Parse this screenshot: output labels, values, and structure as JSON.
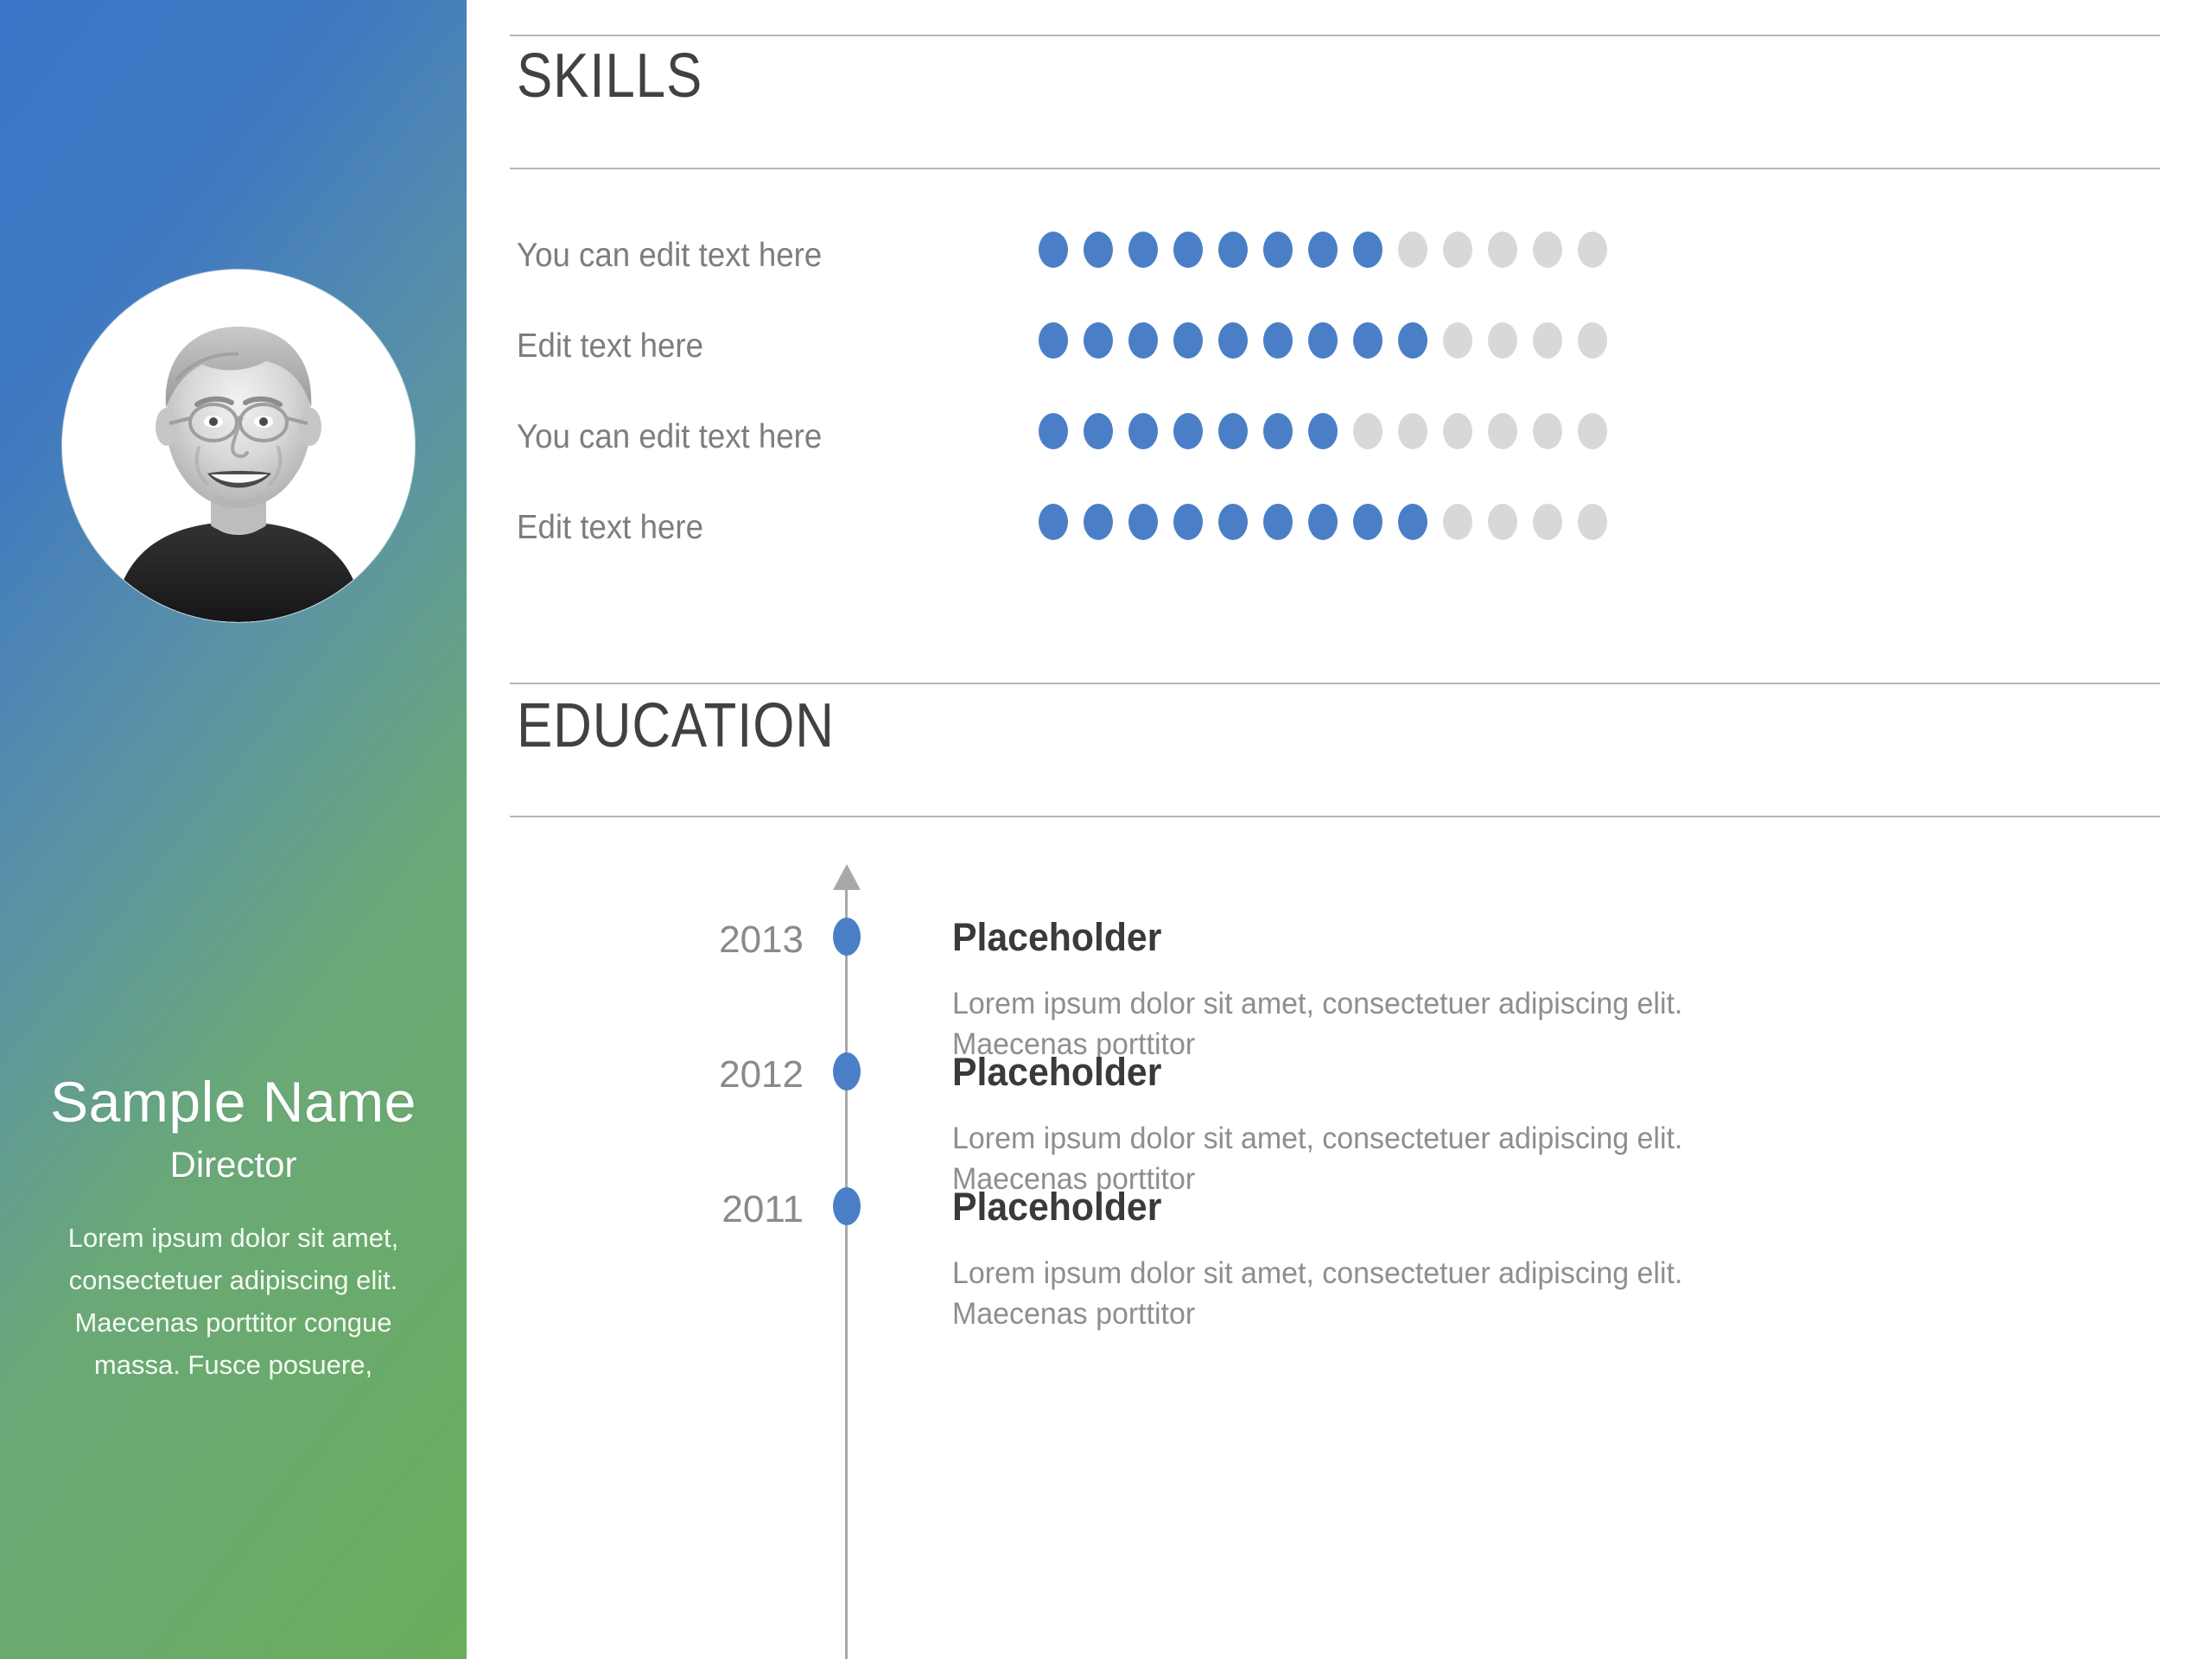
{
  "profile": {
    "name": "Sample Name",
    "role": "Director",
    "bio": "Lorem ipsum dolor sit amet, consectetuer adipiscing elit. Maecenas porttitor congue massa. Fusce posuere,",
    "photo_alt": "portrait-photo",
    "gradient_start": "#3a74c6",
    "gradient_end": "#6aad5c"
  },
  "skills": {
    "title": "SKILLS",
    "dots_total": 13,
    "accent_color": "#4a7fc8",
    "empty_color": "#d8d8d8",
    "items": [
      {
        "label": "You can edit text here",
        "filled": 8
      },
      {
        "label": "Edit text here",
        "filled": 9
      },
      {
        "label": "You can edit text here",
        "filled": 7
      },
      {
        "label": "Edit text here",
        "filled": 9
      }
    ]
  },
  "education": {
    "title": "EDUCATION",
    "entries": [
      {
        "year": "2013",
        "title": "Placeholder",
        "description": "Lorem ipsum dolor sit amet, consectetuer adipiscing elit. Maecenas porttitor"
      },
      {
        "year": "2012",
        "title": "Placeholder",
        "description": "Lorem ipsum dolor sit amet, consectetuer adipiscing elit. Maecenas porttitor"
      },
      {
        "year": "2011",
        "title": "Placeholder",
        "description": "Lorem ipsum dolor sit amet, consectetuer adipiscing elit. Maecenas porttitor"
      }
    ]
  }
}
